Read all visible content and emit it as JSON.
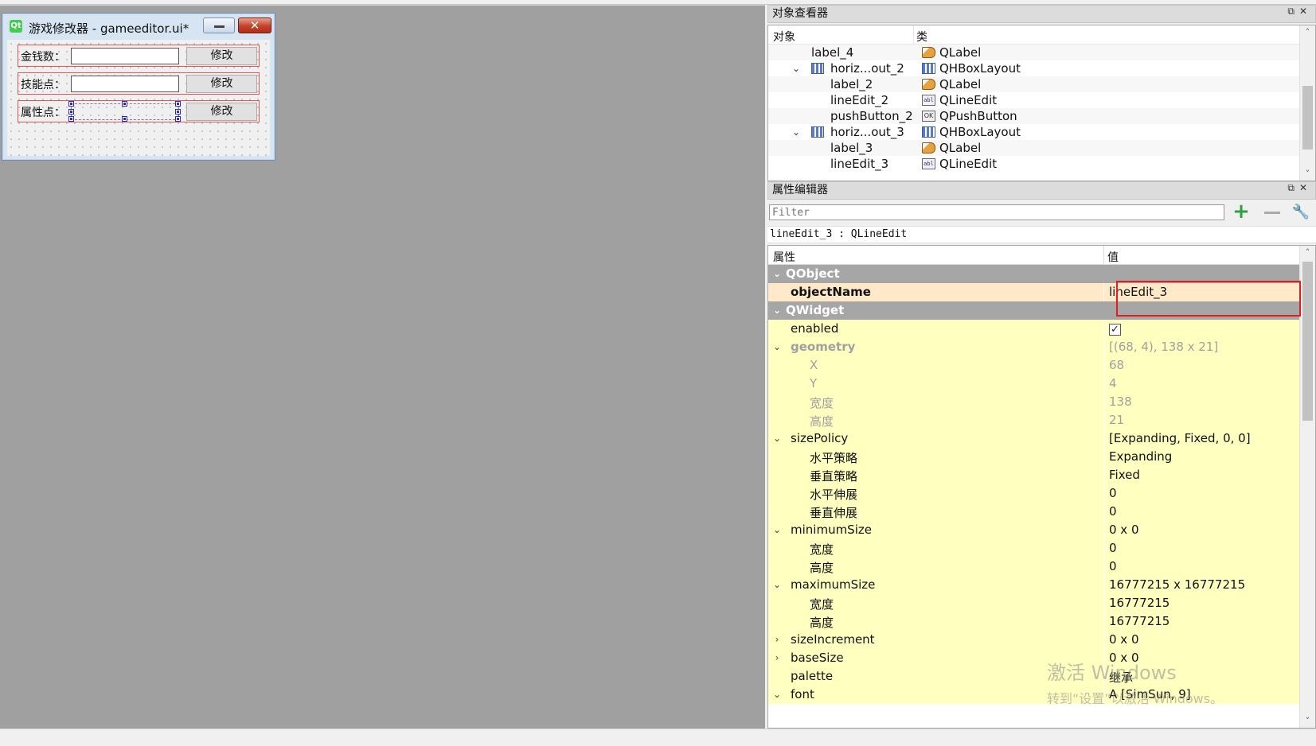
{
  "form": {
    "title": "游戏修改器 - gameeditor.ui*",
    "logo": "Qt",
    "close_glyph": "✕",
    "rows": [
      {
        "label": "金钱数：",
        "button": "修改"
      },
      {
        "label": "技能点：",
        "button": "修改"
      },
      {
        "label": "属性点：",
        "button": "修改"
      }
    ]
  },
  "object_inspector": {
    "title": "对象查看器",
    "dock_buttons": "⧉✕",
    "col_object": "对象",
    "col_class": "类",
    "rows": [
      {
        "name": "label_4",
        "cls": "QLabel",
        "icon": "label-icon"
      },
      {
        "name": "horiz...out_2",
        "cls": "QHBoxLayout",
        "icon": "layout-icon",
        "expand": "⌄"
      },
      {
        "name": "label_2",
        "cls": "QLabel",
        "icon": "label-icon"
      },
      {
        "name": "lineEdit_2",
        "cls": "QLineEdit",
        "icon": "lineedit-icon"
      },
      {
        "name": "pushButton_2",
        "cls": "QPushButton",
        "icon": "pushbutton-icon"
      },
      {
        "name": "horiz...out_3",
        "cls": "QHBoxLayout",
        "icon": "layout-icon",
        "expand": "⌄"
      },
      {
        "name": "label_3",
        "cls": "QLabel",
        "icon": "label-icon"
      },
      {
        "name": "lineEdit_3",
        "cls": "QLineEdit",
        "icon": "lineedit-icon"
      }
    ]
  },
  "property_editor": {
    "title": "属性编辑器",
    "dock_buttons": "⧉✕",
    "filter_placeholder": "Filter",
    "add_glyph": "+",
    "wrench_glyph": "🔧",
    "class_line": "lineEdit_3 : QLineEdit",
    "col_property": "属性",
    "col_value": "值",
    "rows": [
      {
        "kind": "group",
        "name": "QObject",
        "expand": "⌄"
      },
      {
        "kind": "orange",
        "name": "objectName",
        "value": "lineEdit_3",
        "bold": true
      },
      {
        "kind": "group",
        "name": "QWidget",
        "expand": "⌄"
      },
      {
        "kind": "yellow",
        "name": "enabled",
        "checkbox": true,
        "check": "✓"
      },
      {
        "kind": "yellow",
        "name": "geometry",
        "value": "[(68, 4), 138 x 21]",
        "expand": "⌄",
        "dim": true,
        "bold": true
      },
      {
        "kind": "yellow",
        "name": "X",
        "value": "68",
        "child": true,
        "dim": true
      },
      {
        "kind": "yellow",
        "name": "Y",
        "value": "4",
        "child": true,
        "dim": true
      },
      {
        "kind": "yellow",
        "name": "宽度",
        "value": "138",
        "child": true,
        "dim": true
      },
      {
        "kind": "yellow",
        "name": "高度",
        "value": "21",
        "child": true,
        "dim": true
      },
      {
        "kind": "yellow",
        "name": "sizePolicy",
        "value": "[Expanding, Fixed, 0, 0]",
        "expand": "⌄"
      },
      {
        "kind": "yellow",
        "name": "水平策略",
        "value": "Expanding",
        "child": true
      },
      {
        "kind": "yellow",
        "name": "垂直策略",
        "value": "Fixed",
        "child": true
      },
      {
        "kind": "yellow",
        "name": "水平伸展",
        "value": "0",
        "child": true
      },
      {
        "kind": "yellow",
        "name": "垂直伸展",
        "value": "0",
        "child": true
      },
      {
        "kind": "yellow",
        "name": "minimumSize",
        "value": "0 x 0",
        "expand": "⌄"
      },
      {
        "kind": "yellow",
        "name": "宽度",
        "value": "0",
        "child": true
      },
      {
        "kind": "yellow",
        "name": "高度",
        "value": "0",
        "child": true
      },
      {
        "kind": "yellow",
        "name": "maximumSize",
        "value": "16777215 x 16777215",
        "expand": "⌄"
      },
      {
        "kind": "yellow",
        "name": "宽度",
        "value": "16777215",
        "child": true
      },
      {
        "kind": "yellow",
        "name": "高度",
        "value": "16777215",
        "child": true
      },
      {
        "kind": "yellow",
        "name": "sizeIncrement",
        "value": "0 x 0",
        "expand": "›"
      },
      {
        "kind": "yellow",
        "name": "baseSize",
        "value": "0 x 0",
        "expand": "›"
      },
      {
        "kind": "yellow",
        "name": "palette",
        "value": "继承"
      },
      {
        "kind": "yellow",
        "name": "font",
        "value": "A  [SimSun, 9]",
        "expand": "⌄"
      }
    ]
  },
  "scrollbar": {
    "up": "˄",
    "down": "˅"
  },
  "watermark": {
    "line1": "激活 Windows",
    "line2": "转到“设置”以激活 Windows。"
  }
}
